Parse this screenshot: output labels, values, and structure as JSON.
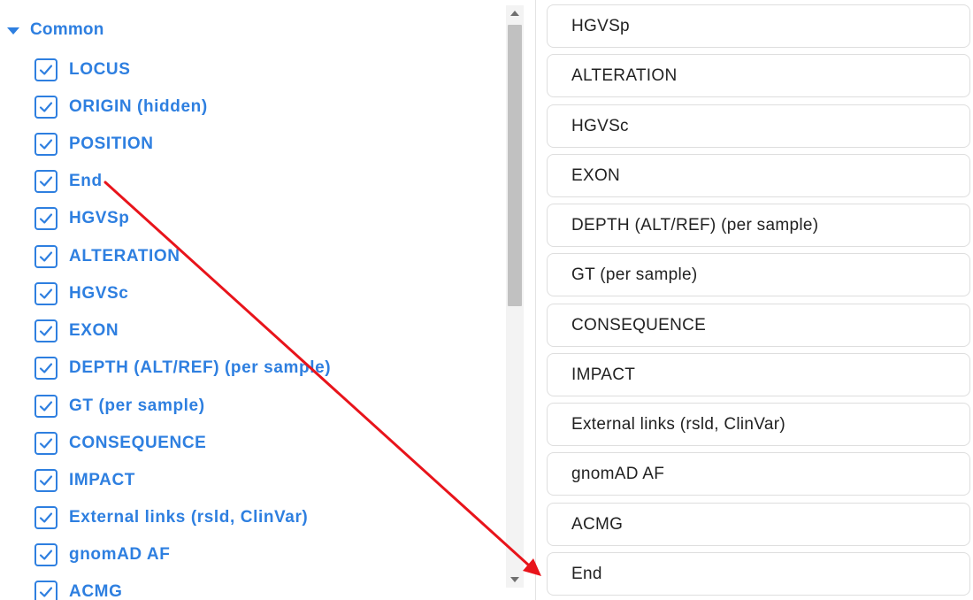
{
  "group": {
    "label": "Common",
    "icon": "caret-down-icon"
  },
  "columns": [
    {
      "label": "LOCUS",
      "checked": true
    },
    {
      "label": "ORIGIN (hidden)",
      "checked": true
    },
    {
      "label": "POSITION",
      "checked": true
    },
    {
      "label": "End",
      "checked": true
    },
    {
      "label": "HGVSp",
      "checked": true
    },
    {
      "label": "ALTERATION",
      "checked": true
    },
    {
      "label": "HGVSc",
      "checked": true
    },
    {
      "label": "EXON",
      "checked": true
    },
    {
      "label": "DEPTH (ALT/REF) (per sample)",
      "checked": true
    },
    {
      "label": "GT (per sample)",
      "checked": true
    },
    {
      "label": "CONSEQUENCE",
      "checked": true
    },
    {
      "label": "IMPACT",
      "checked": true
    },
    {
      "label": "External links (rsld, ClinVar)",
      "checked": true
    },
    {
      "label": "gnomAD AF",
      "checked": true
    },
    {
      "label": "ACMG",
      "checked": true
    }
  ],
  "order_list": [
    "HGVSp",
    "ALTERATION",
    "HGVSc",
    "EXON",
    "DEPTH (ALT/REF) (per sample)",
    "GT (per sample)",
    "CONSEQUENCE",
    "IMPACT",
    "External links (rsld, ClinVar)",
    "gnomAD AF",
    "ACMG",
    "End"
  ],
  "colors": {
    "accent": "#2e7fe0",
    "annotation_arrow": "#e8141b",
    "card_border": "#dedede",
    "card_text": "#222222"
  }
}
